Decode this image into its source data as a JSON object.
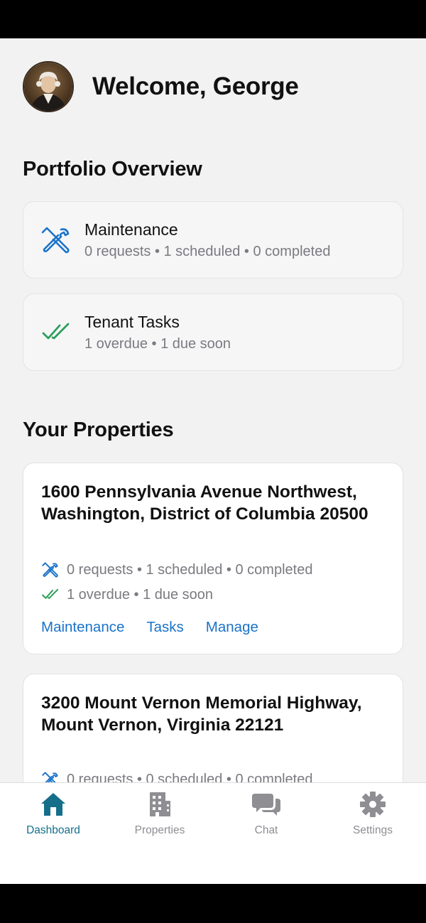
{
  "header": {
    "welcome": "Welcome, George"
  },
  "portfolio": {
    "title": "Portfolio Overview",
    "maintenance": {
      "title": "Maintenance",
      "summary": "0 requests • 1 scheduled • 0 completed",
      "icon": "tools-icon"
    },
    "tenant_tasks": {
      "title": "Tenant Tasks",
      "summary": "1 overdue • 1 due soon",
      "icon": "double-check-icon"
    }
  },
  "properties": {
    "title": "Your Properties",
    "items": [
      {
        "address": "1600 Pennsylvania Avenue Northwest, Washington, District of Columbia 20500",
        "maintenance": "0 requests • 1 scheduled • 0 completed",
        "tasks": "1 overdue • 1 due soon",
        "links": [
          "Maintenance",
          "Tasks",
          "Manage"
        ]
      },
      {
        "address": "3200 Mount Vernon Memorial Highway, Mount Vernon, Virginia 22121",
        "maintenance": "0 requests • 0 scheduled • 0 completed"
      }
    ]
  },
  "tabbar": {
    "tabs": [
      {
        "label": "Dashboard",
        "icon": "home-icon",
        "active": true
      },
      {
        "label": "Properties",
        "icon": "building-icon",
        "active": false
      },
      {
        "label": "Chat",
        "icon": "chat-icon",
        "active": false
      },
      {
        "label": "Settings",
        "icon": "gear-icon",
        "active": false
      }
    ]
  },
  "colors": {
    "accent_link": "#1a73c9",
    "tools_icon": "#1a73c9",
    "check_icon": "#2e9e5b",
    "active_tab": "#156f8a",
    "inactive_tab": "#8e8e93"
  }
}
